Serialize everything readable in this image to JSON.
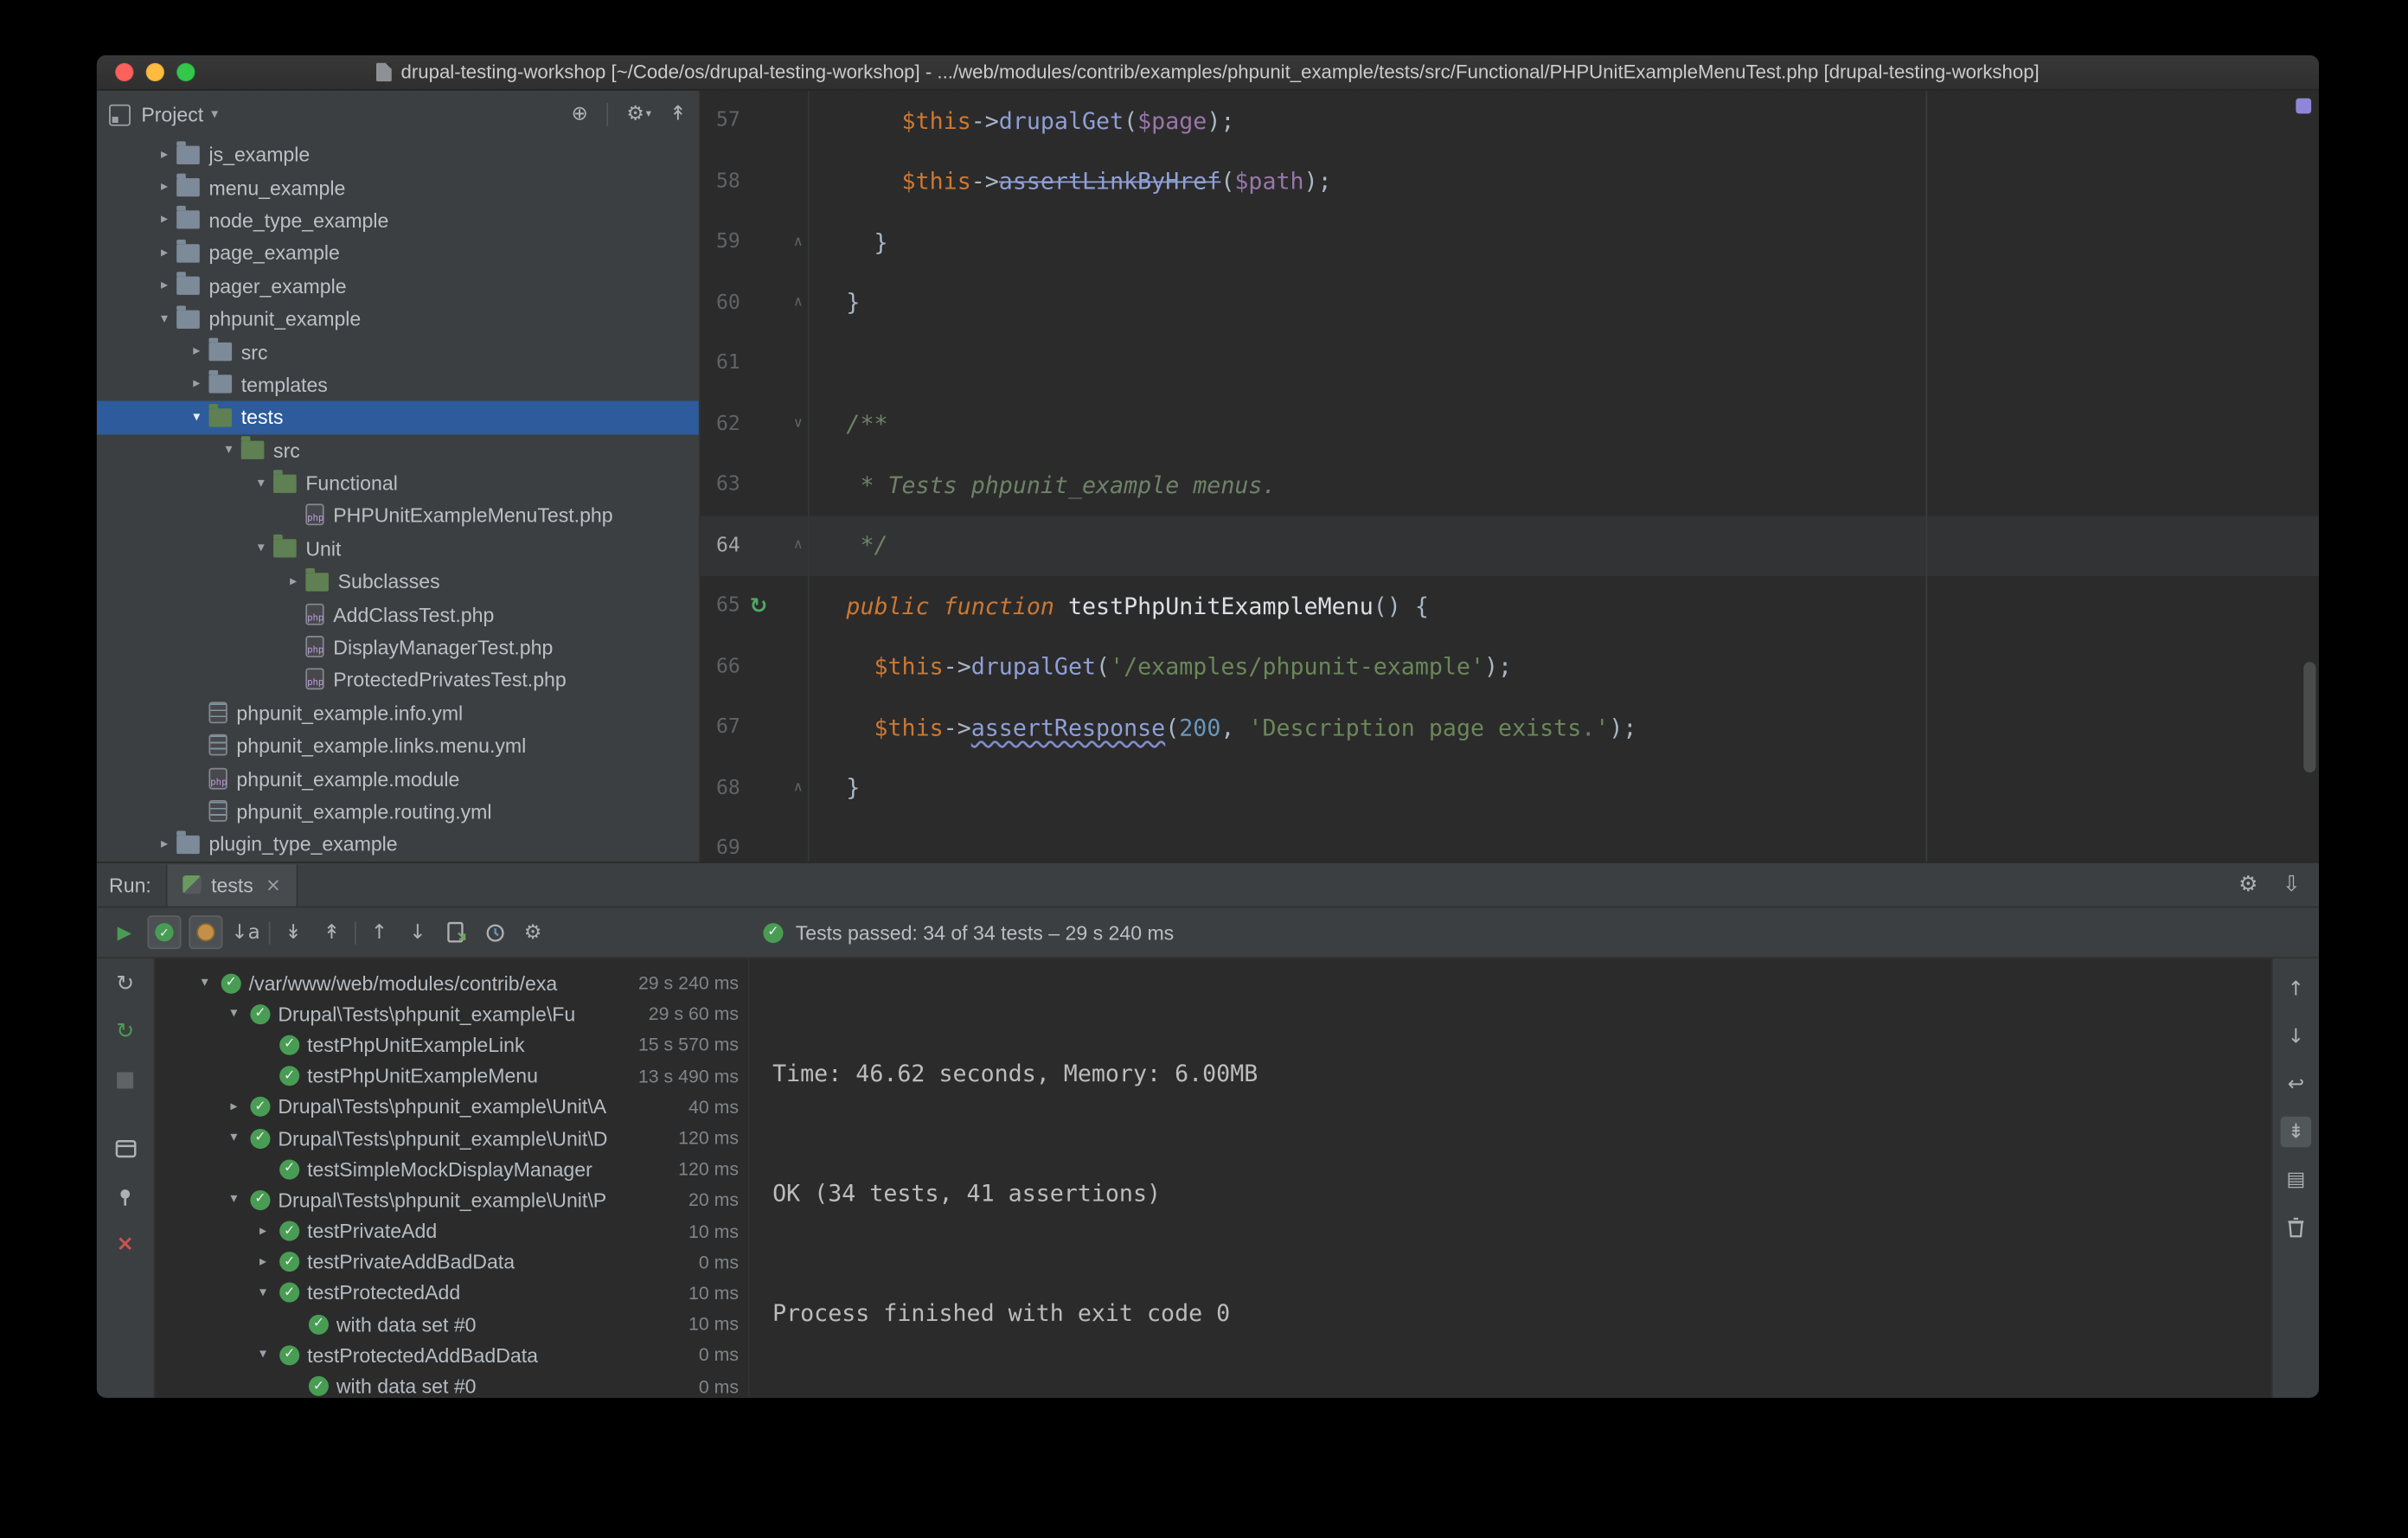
{
  "icons": {
    "chevron_down": "▾",
    "chevron_right": "▸",
    "check": "✓",
    "close": "×",
    "gear": "⚙",
    "run": "▶",
    "rerun": "↻",
    "stop": "■",
    "sort_alpha": "↓a",
    "expand_all": "↡",
    "collapse_all": "↟",
    "arrow_up": "↑",
    "arrow_down": "↓",
    "soft_wrap": "↩",
    "scroll_end": "⇟",
    "hide": "⇩",
    "locate": "⊕",
    "fold_start": "∨",
    "fold_end": "∧",
    "run_gutter": "↻",
    "print": "▤",
    "php_badge": "php"
  },
  "window": {
    "title": "drupal-testing-workshop [~/Code/os/drupal-testing-workshop] - .../web/modules/contrib/examples/phpunit_example/tests/src/Functional/PHPUnitExampleMenuTest.php [drupal-testing-workshop]"
  },
  "project": {
    "header": {
      "title": "Project"
    },
    "tree": [
      {
        "label": "js_example",
        "kind": "folder",
        "indent": 1,
        "expand": "collapsed"
      },
      {
        "label": "menu_example",
        "kind": "folder",
        "indent": 1,
        "expand": "collapsed"
      },
      {
        "label": "node_type_example",
        "kind": "folder",
        "indent": 1,
        "expand": "collapsed"
      },
      {
        "label": "page_example",
        "kind": "folder",
        "indent": 1,
        "expand": "collapsed"
      },
      {
        "label": "pager_example",
        "kind": "folder",
        "indent": 1,
        "expand": "collapsed"
      },
      {
        "label": "phpunit_example",
        "kind": "folder",
        "indent": 1,
        "expand": "expanded"
      },
      {
        "label": "src",
        "kind": "folder",
        "indent": 2,
        "expand": "collapsed"
      },
      {
        "label": "templates",
        "kind": "folder",
        "indent": 2,
        "expand": "collapsed"
      },
      {
        "label": "tests",
        "kind": "folder-test",
        "indent": 2,
        "expand": "expanded",
        "selected": true
      },
      {
        "label": "src",
        "kind": "folder-test",
        "indent": 3,
        "expand": "expanded"
      },
      {
        "label": "Functional",
        "kind": "folder-test",
        "indent": 4,
        "expand": "expanded"
      },
      {
        "label": "PHPUnitExampleMenuTest.php",
        "kind": "php",
        "indent": 5
      },
      {
        "label": "Unit",
        "kind": "folder-test",
        "indent": 4,
        "expand": "expanded"
      },
      {
        "label": "Subclasses",
        "kind": "folder-test",
        "indent": 5,
        "expand": "collapsed"
      },
      {
        "label": "AddClassTest.php",
        "kind": "php",
        "indent": 5
      },
      {
        "label": "DisplayManagerTest.php",
        "kind": "php",
        "indent": 5
      },
      {
        "label": "ProtectedPrivatesTest.php",
        "kind": "php",
        "indent": 5
      },
      {
        "label": "phpunit_example.info.yml",
        "kind": "yml",
        "indent": 2
      },
      {
        "label": "phpunit_example.links.menu.yml",
        "kind": "yml",
        "indent": 2
      },
      {
        "label": "phpunit_example.module",
        "kind": "php",
        "indent": 2
      },
      {
        "label": "phpunit_example.routing.yml",
        "kind": "yml",
        "indent": 2
      },
      {
        "label": "plugin_type_example",
        "kind": "folder",
        "indent": 1,
        "expand": "collapsed"
      }
    ]
  },
  "editor": {
    "lines": [
      {
        "num": "57",
        "segs": [
          {
            "t": "      ",
            "c": "pl"
          },
          {
            "t": "$this",
            "c": "th"
          },
          {
            "t": "->",
            "c": "pl"
          },
          {
            "t": "drupalGet",
            "c": "me"
          },
          {
            "t": "(",
            "c": "pl"
          },
          {
            "t": "$page",
            "c": "va"
          },
          {
            "t": ");",
            "c": "pl"
          }
        ]
      },
      {
        "num": "58",
        "segs": [
          {
            "t": "      ",
            "c": "pl"
          },
          {
            "t": "$this",
            "c": "th"
          },
          {
            "t": "->",
            "c": "pl"
          },
          {
            "t": "assertLinkByHref",
            "c": "me st"
          },
          {
            "t": "(",
            "c": "pl"
          },
          {
            "t": "$path",
            "c": "va"
          },
          {
            "t": ");",
            "c": "pl"
          }
        ]
      },
      {
        "num": "59",
        "fold": "end",
        "segs": [
          {
            "t": "    }",
            "c": "pl"
          }
        ]
      },
      {
        "num": "60",
        "fold": "end",
        "segs": [
          {
            "t": "  }",
            "c": "pl"
          }
        ]
      },
      {
        "num": "61",
        "segs": []
      },
      {
        "num": "62",
        "fold": "start",
        "segs": [
          {
            "t": "  /**",
            "c": "cm"
          }
        ]
      },
      {
        "num": "63",
        "segs": [
          {
            "t": "   * Tests phpunit_example menus.",
            "c": "cm"
          }
        ]
      },
      {
        "num": "64",
        "fold": "end",
        "cur": true,
        "segs": [
          {
            "t": "   */",
            "c": "cm"
          }
        ]
      },
      {
        "num": "65",
        "run": true,
        "segs": [
          {
            "t": "  ",
            "c": "pl"
          },
          {
            "t": "public function",
            "c": "kw"
          },
          {
            "t": " ",
            "c": "pl"
          },
          {
            "t": "testPhpUnitExampleMenu",
            "c": "fn"
          },
          {
            "t": "() {",
            "c": "pl"
          }
        ]
      },
      {
        "num": "66",
        "segs": [
          {
            "t": "    ",
            "c": "pl"
          },
          {
            "t": "$this",
            "c": "th"
          },
          {
            "t": "->",
            "c": "pl"
          },
          {
            "t": "drupalGet",
            "c": "me"
          },
          {
            "t": "(",
            "c": "pl"
          },
          {
            "t": "'/examples/phpunit-example'",
            "c": "sr"
          },
          {
            "t": ");",
            "c": "pl"
          }
        ]
      },
      {
        "num": "67",
        "segs": [
          {
            "t": "    ",
            "c": "pl"
          },
          {
            "t": "$this",
            "c": "th"
          },
          {
            "t": "->",
            "c": "pl"
          },
          {
            "t": "assertResponse",
            "c": "me un"
          },
          {
            "t": "(",
            "c": "pl"
          },
          {
            "t": "200",
            "c": "nu"
          },
          {
            "t": ", ",
            "c": "pl"
          },
          {
            "t": "'Description page exists.'",
            "c": "sr"
          },
          {
            "t": ");",
            "c": "pl"
          }
        ]
      },
      {
        "num": "68",
        "fold": "end",
        "segs": [
          {
            "t": "  }",
            "c": "pl"
          }
        ]
      },
      {
        "num": "69",
        "segs": []
      }
    ]
  },
  "run": {
    "label": "Run:",
    "tab": "tests",
    "status": "Tests passed: 34 of 34 tests – 29 s 240 ms",
    "tree": [
      {
        "name": "/var/www/web/modules/contrib/exa",
        "time": "29 s 240 ms",
        "indent": 0,
        "expand": "expanded"
      },
      {
        "name": "Drupal\\Tests\\phpunit_example\\Fu",
        "time": "29 s 60 ms",
        "indent": 1,
        "expand": "expanded"
      },
      {
        "name": "testPhpUnitExampleLink",
        "time": "15 s 570 ms",
        "indent": 2
      },
      {
        "name": "testPhpUnitExampleMenu",
        "time": "13 s 490 ms",
        "indent": 2
      },
      {
        "name": "Drupal\\Tests\\phpunit_example\\Unit\\A",
        "time": "40 ms",
        "indent": 1,
        "expand": "collapsed"
      },
      {
        "name": "Drupal\\Tests\\phpunit_example\\Unit\\D",
        "time": "120 ms",
        "indent": 1,
        "expand": "expanded"
      },
      {
        "name": "testSimpleMockDisplayManager",
        "time": "120 ms",
        "indent": 2
      },
      {
        "name": "Drupal\\Tests\\phpunit_example\\Unit\\P",
        "time": "20 ms",
        "indent": 1,
        "expand": "expanded"
      },
      {
        "name": "testPrivateAdd",
        "time": "10 ms",
        "indent": 2,
        "expand": "collapsed"
      },
      {
        "name": "testPrivateAddBadData",
        "time": "0 ms",
        "indent": 2,
        "expand": "collapsed"
      },
      {
        "name": "testProtectedAdd",
        "time": "10 ms",
        "indent": 2,
        "expand": "expanded"
      },
      {
        "name": "with data set #0",
        "time": "10 ms",
        "indent": 3
      },
      {
        "name": "testProtectedAddBadData",
        "time": "0 ms",
        "indent": 2,
        "expand": "expanded"
      },
      {
        "name": "with data set #0",
        "time": "0 ms",
        "indent": 3
      }
    ],
    "console": [
      "Time: 46.62 seconds, Memory: 6.00MB",
      "OK (34 tests, 41 assertions)",
      "Process finished with exit code 0"
    ]
  }
}
